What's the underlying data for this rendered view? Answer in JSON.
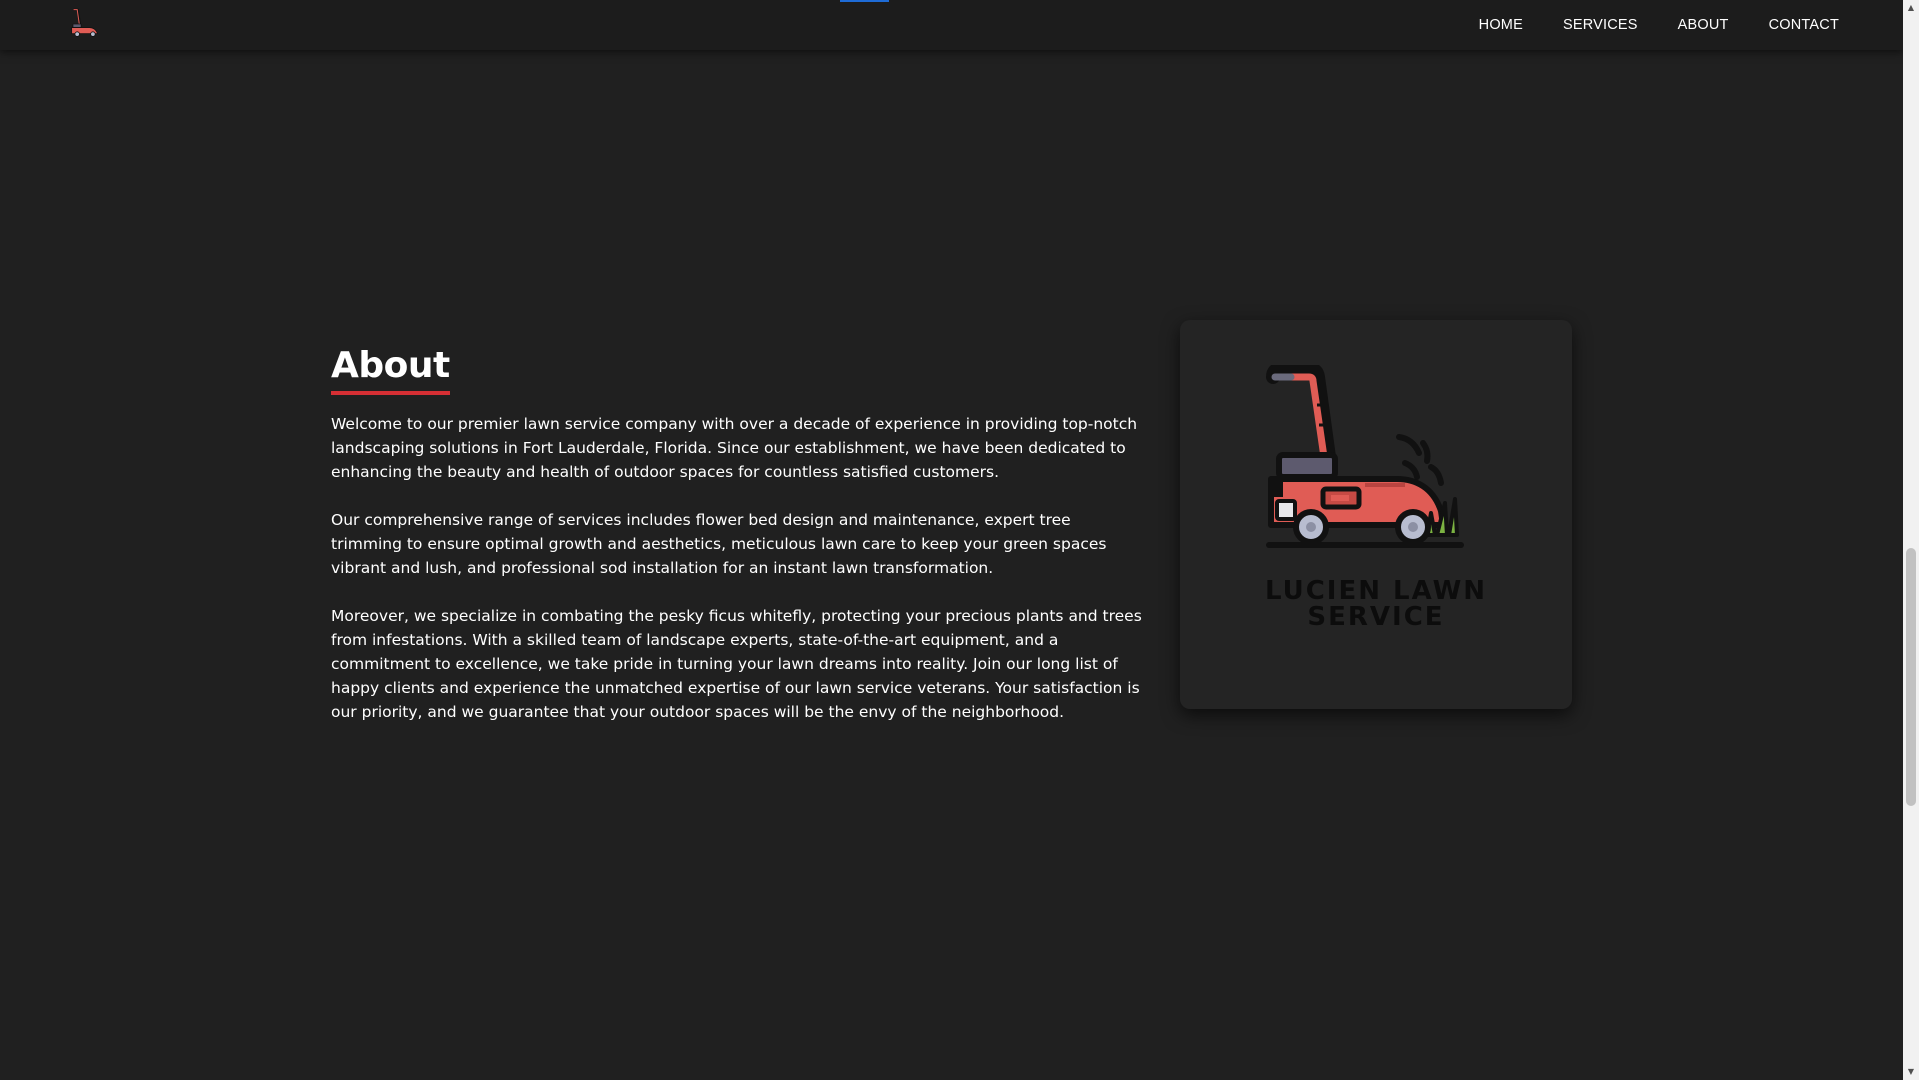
{
  "nav": {
    "logo_icon": "lawn-mower-icon",
    "links": [
      "HOME",
      "SERVICES",
      "ABOUT",
      "CONTACT"
    ],
    "active_indicator_color": "#1e6bd6"
  },
  "about": {
    "title": "About",
    "underline_color": "#d62f34",
    "paragraphs": [
      "Welcome to our premier lawn service company with over a decade of experience in providing top-notch landscaping solutions in Fort Lauderdale, Florida. Since our establishment, we have been dedicated to enhancing the beauty and health of outdoor spaces for countless satisfied customers.",
      "Our comprehensive range of services includes flower bed design and maintenance, expert tree trimming to ensure optimal growth and aesthetics, meticulous lawn care to keep your green spaces vibrant and lush, and professional sod installation for an instant lawn transformation.",
      "Moreover, we specialize in combating the pesky ficus whitefly, protecting your precious plants and trees from infestations. With a skilled team of landscape experts, state-of-the-art equipment, and a commitment to excellence, we take pride in turning your lawn dreams into reality. Join our long list of happy clients and experience the unmatched expertise of our lawn service veterans. Your satisfaction is our priority, and we guarantee that your outdoor spaces will be the envy of the neighborhood."
    ]
  },
  "logo_card": {
    "icon": "lawn-mower-icon",
    "brand_line_1": "LUCIEN LAWN",
    "brand_line_2": "SERVICE",
    "mower_color": "#e05c55",
    "grass_color": "#7cb342"
  },
  "scrollbar": {
    "up_arrow": "▲",
    "down_arrow": "▼"
  }
}
